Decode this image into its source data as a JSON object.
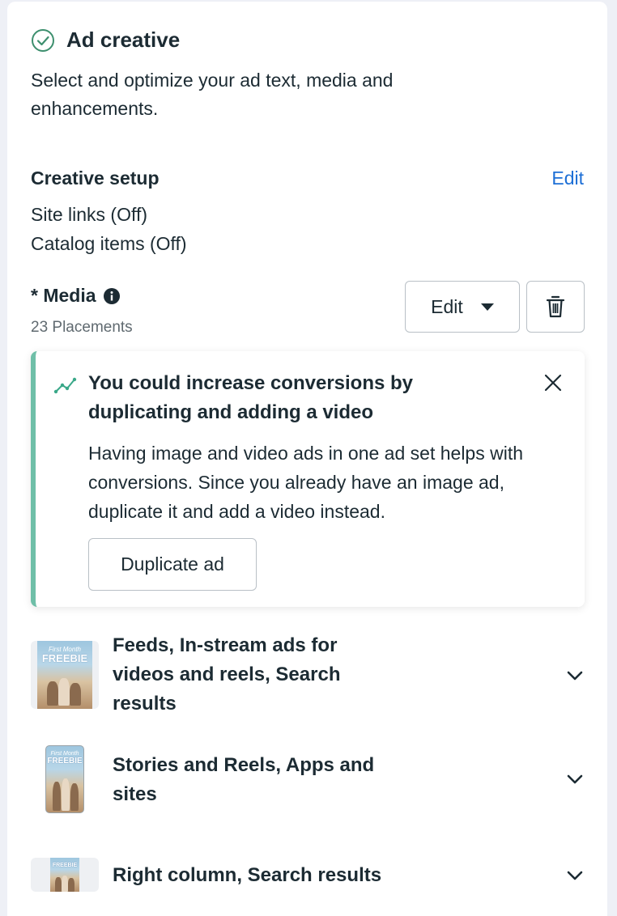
{
  "header": {
    "title": "Ad creative",
    "subtitle": "Select and optimize your ad text, media and enhancements."
  },
  "creative_setup": {
    "title": "Creative setup",
    "edit_label": "Edit",
    "lines": [
      "Site links (Off)",
      "Catalog items (Off)"
    ]
  },
  "media": {
    "label": "* Media",
    "placements": "23 Placements",
    "edit_label": "Edit"
  },
  "tip": {
    "title": "You could increase conversions by duplicating and adding a video",
    "body": "Having image and video ads in one ad set helps with conversions. Since you already have an image ad, duplicate it and add a video instead.",
    "button": "Duplicate ad"
  },
  "placements": [
    {
      "label": "Feeds, In-stream ads for videos and reels, Search results"
    },
    {
      "label": "Stories and Reels, Apps and sites"
    },
    {
      "label": "Right column, Search results"
    }
  ],
  "thumbnail": {
    "line1": "First Month",
    "line2": "FREEBIE"
  },
  "colors": {
    "accent_link": "#1d6fd6",
    "tip_border": "#6fbfa8",
    "check_green": "#3d8f6e"
  }
}
